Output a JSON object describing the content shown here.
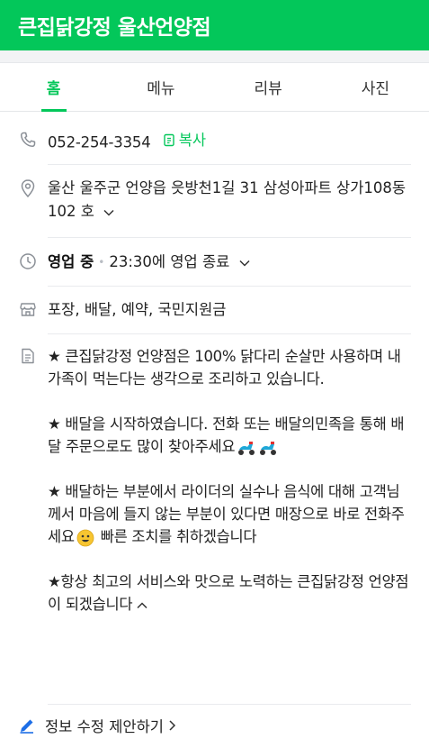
{
  "header": {
    "title": "큰집닭강정 울산언양점"
  },
  "tabs": [
    {
      "label": "홈",
      "active": true
    },
    {
      "label": "메뉴",
      "active": false
    },
    {
      "label": "리뷰",
      "active": false
    },
    {
      "label": "사진",
      "active": false
    }
  ],
  "info": {
    "phone": "052-254-3354",
    "copy_label": "복사",
    "address": "울산 울주군 언양읍 읏방천1길 31 삼성아파트 상가108동 102 호",
    "status": "영업 중",
    "hours_text": "23:30에 영업 종료",
    "services": "포장, 배달, 예약, 국민지원금",
    "description_1": "★ 큰집닭강정 언양점은 100% 닭다리 순살만 사용하며 내 가족이 먹는다는 생각으로 조리하고 있습니다.",
    "description_2": "★ 배달을 시작하였습니다. 전화 또는 배달의민족을 통해 배달 주문으로도 많이 찾아주세요",
    "description_3a": "★ 배달하는 부분에서 라이더의 실수나 음식에 대해 고객님께서 마음에 들지 않는 부분이 있다면 매장으로 바로 전화주세요",
    "description_3b": " 빠른 조치를 취하겠습니다",
    "description_4": "★항상 최고의 서비스와 맛으로 노력하는 큰집닭강정 언양점이 되겠습니다"
  },
  "footer": {
    "edit_label": "정보 수정 제안하기"
  },
  "colors": {
    "brand": "#03c75a",
    "divider": "#e9ebee"
  }
}
